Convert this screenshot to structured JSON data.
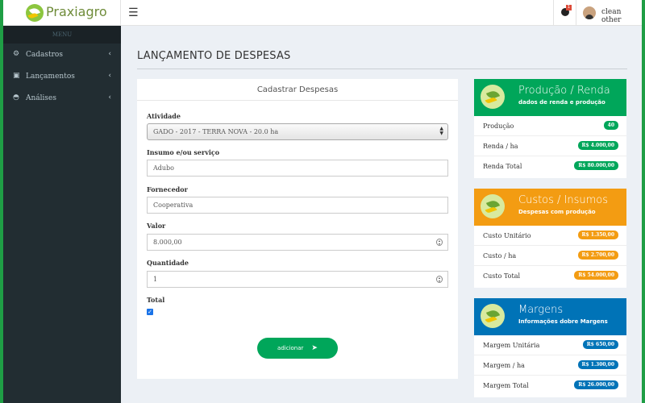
{
  "colors": {
    "green": "#00a65a",
    "orange": "#f39c12",
    "blue": "#0073b7",
    "sidebar": "#222d32"
  },
  "header": {
    "logo_text": "Praxiagro",
    "notification_count": "1",
    "user_name": "clean other"
  },
  "sidebar": {
    "menu_label": "MENU",
    "items": [
      {
        "label": "Cadastros",
        "icon": "gear-icon"
      },
      {
        "label": "Lançamentos",
        "icon": "money-icon"
      },
      {
        "label": "Análises",
        "icon": "dashboard-icon"
      }
    ]
  },
  "page": {
    "title": "LANÇAMENTO DE DESPESAS"
  },
  "form": {
    "header": "Cadastrar Despesas",
    "atividade_label": "Atividade",
    "atividade_value": "GADO - 2017 - TERRA NOVA - 20.0 ha",
    "insumo_label": "Insumo e/ou serviço",
    "insumo_value": "Adubo",
    "fornecedor_label": "Fornecedor",
    "fornecedor_value": "Cooperativa",
    "valor_label": "Valor",
    "valor_value": "8.000,00",
    "quantidade_label": "Quantidade",
    "quantidade_value": "1",
    "total_label": "Total",
    "total_checked": true,
    "submit_label": "adicionar"
  },
  "cards": {
    "producao": {
      "title": "Produção / Renda",
      "subtitle": "dados de renda e produção",
      "rows": [
        {
          "label": "Produção",
          "value": "40"
        },
        {
          "label": "Renda / ha",
          "value": "R$ 4.000,00"
        },
        {
          "label": "Renda Total",
          "value": "R$ 80.000,00"
        }
      ]
    },
    "custos": {
      "title": "Custos / Insumos",
      "subtitle": "Despesas com produção",
      "rows": [
        {
          "label": "Custo Unitário",
          "value": "R$ 1.350,00"
        },
        {
          "label": "Custo / ha",
          "value": "R$ 2.700,00"
        },
        {
          "label": "Custo Total",
          "value": "R$ 54.000,00"
        }
      ]
    },
    "margens": {
      "title": "Margens",
      "subtitle": "Informações dobre Margens",
      "rows": [
        {
          "label": "Margem Unitária",
          "value": "R$ 650,00"
        },
        {
          "label": "Margem / ha",
          "value": "R$ 1.300,00"
        },
        {
          "label": "Margem Total",
          "value": "R$ 26.000,00"
        }
      ]
    }
  }
}
